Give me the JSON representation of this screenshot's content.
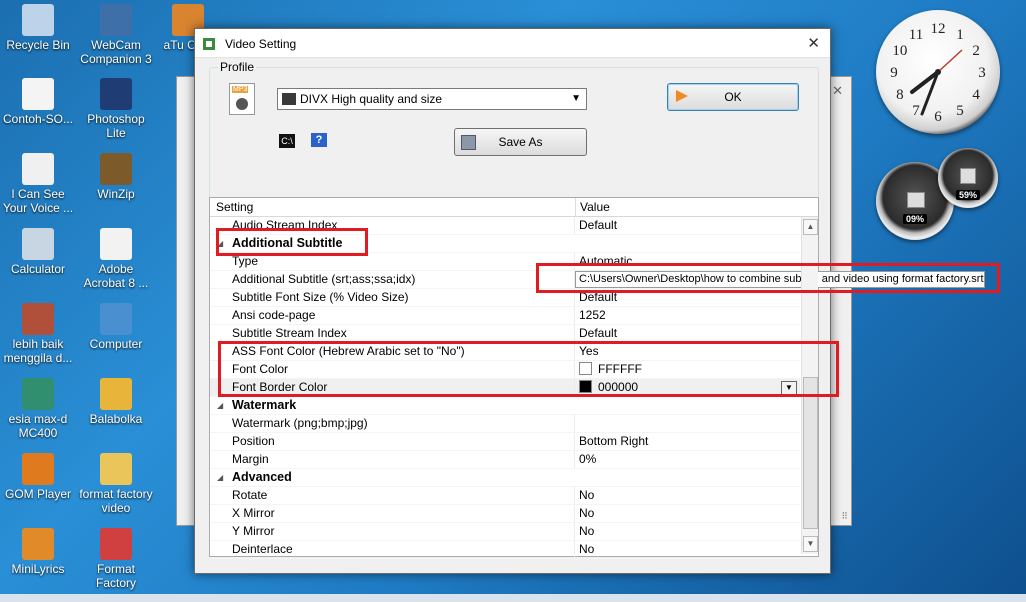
{
  "desktop": {
    "icons": [
      {
        "label": "Recycle Bin",
        "icon": "recycle-bin-icon",
        "color": "#bcd3ea"
      },
      {
        "label": "WebCam Companion 3",
        "icon": "webcam-icon",
        "color": "#3f6fa8"
      },
      {
        "label": "aTu Cate",
        "icon": "atube-catcher-icon",
        "color": "#d9842f"
      },
      {
        "label": "Contoh-SO...",
        "icon": "document-icon",
        "color": "#f4f4f4"
      },
      {
        "label": "Photoshop Lite",
        "icon": "photoshop-icon",
        "color": "#1f3c74"
      },
      {
        "label": "I Can See Your Voice ...",
        "icon": "mp3-file-icon",
        "color": "#f0f0f0"
      },
      {
        "label": "WinZip",
        "icon": "winzip-icon",
        "color": "#7c5a2a"
      },
      {
        "label": "Calculator",
        "icon": "calculator-icon",
        "color": "#c8d5e3"
      },
      {
        "label": "Adobe Acrobat 8 ...",
        "icon": "acrobat-icon",
        "color": "#f2f2f2"
      },
      {
        "label": "lebih baik menggila d...",
        "icon": "video-file-icon",
        "color": "#b0503a"
      },
      {
        "label": "Computer",
        "icon": "computer-icon",
        "color": "#4a8fd0"
      },
      {
        "label": "esia max-d MC400",
        "icon": "modem-icon",
        "color": "#2f8f6f"
      },
      {
        "label": "Balabolka",
        "icon": "balabolka-icon",
        "color": "#e8b43a"
      },
      {
        "label": "GOM Player",
        "icon": "gom-player-icon",
        "color": "#e07a1e"
      },
      {
        "label": "format factory video",
        "icon": "folder-icon",
        "color": "#e9c55a"
      },
      {
        "label": "MiniLyrics",
        "icon": "minilyrics-icon",
        "color": "#e08a2a"
      },
      {
        "label": "Format Factory",
        "icon": "format-factory-icon",
        "color": "#d04040"
      }
    ],
    "gauges": {
      "cpu_pct": "09%",
      "mem_pct": "59%"
    },
    "clock_numbers": [
      "12",
      "1",
      "2",
      "3",
      "4",
      "5",
      "6",
      "7",
      "8",
      "9",
      "10",
      "11"
    ]
  },
  "dialog": {
    "title": "Video Setting",
    "profile_legend": "Profile",
    "profile_value": "DIVX High quality and size",
    "ok_label": "OK",
    "save_as_label": "Save As",
    "help_label": "?",
    "cmd_label": "C:\\",
    "grid_headers": {
      "setting": "Setting",
      "value": "Value"
    },
    "rows": [
      {
        "name": "Audio Stream Index",
        "value": "Default",
        "type": "prop"
      },
      {
        "name": "Additional Subtitle",
        "value": "",
        "type": "cat"
      },
      {
        "name": "Type",
        "value": "Automatic",
        "type": "prop"
      },
      {
        "name": "Additional Subtitle (srt;ass;ssa;idx)",
        "value": "",
        "type": "prop"
      },
      {
        "name": "Subtitle Font Size (% Video Size)",
        "value": "Default",
        "type": "prop"
      },
      {
        "name": "Ansi code-page",
        "value": "1252",
        "type": "prop"
      },
      {
        "name": "Subtitle Stream Index",
        "value": "Default",
        "type": "prop"
      },
      {
        "name": "ASS Font Color (Hebrew Arabic set to \"No\")",
        "value": "Yes",
        "type": "prop"
      },
      {
        "name": "Font Color",
        "value": "FFFFFF",
        "type": "prop"
      },
      {
        "name": "Font Border Color",
        "value": "000000",
        "type": "prop"
      },
      {
        "name": "Watermark",
        "value": "",
        "type": "cat"
      },
      {
        "name": "Watermark (png;bmp;jpg)",
        "value": "",
        "type": "prop"
      },
      {
        "name": "Position",
        "value": "Bottom Right",
        "type": "prop"
      },
      {
        "name": "Margin",
        "value": "0%",
        "type": "prop"
      },
      {
        "name": "Advanced",
        "value": "",
        "type": "cat"
      },
      {
        "name": "Rotate",
        "value": "No",
        "type": "prop"
      },
      {
        "name": "X Mirror",
        "value": "No",
        "type": "prop"
      },
      {
        "name": "Y Mirror",
        "value": "No",
        "type": "prop"
      },
      {
        "name": "Deinterlace",
        "value": "No",
        "type": "prop"
      }
    ],
    "subtitle_path": "C:\\Users\\Owner\\Desktop\\how to combine subtitle and video using format factory.srt",
    "colors": {
      "font_color": "#FFFFFF",
      "font_border_color": "#000000",
      "highlight": "#e11b22"
    }
  }
}
